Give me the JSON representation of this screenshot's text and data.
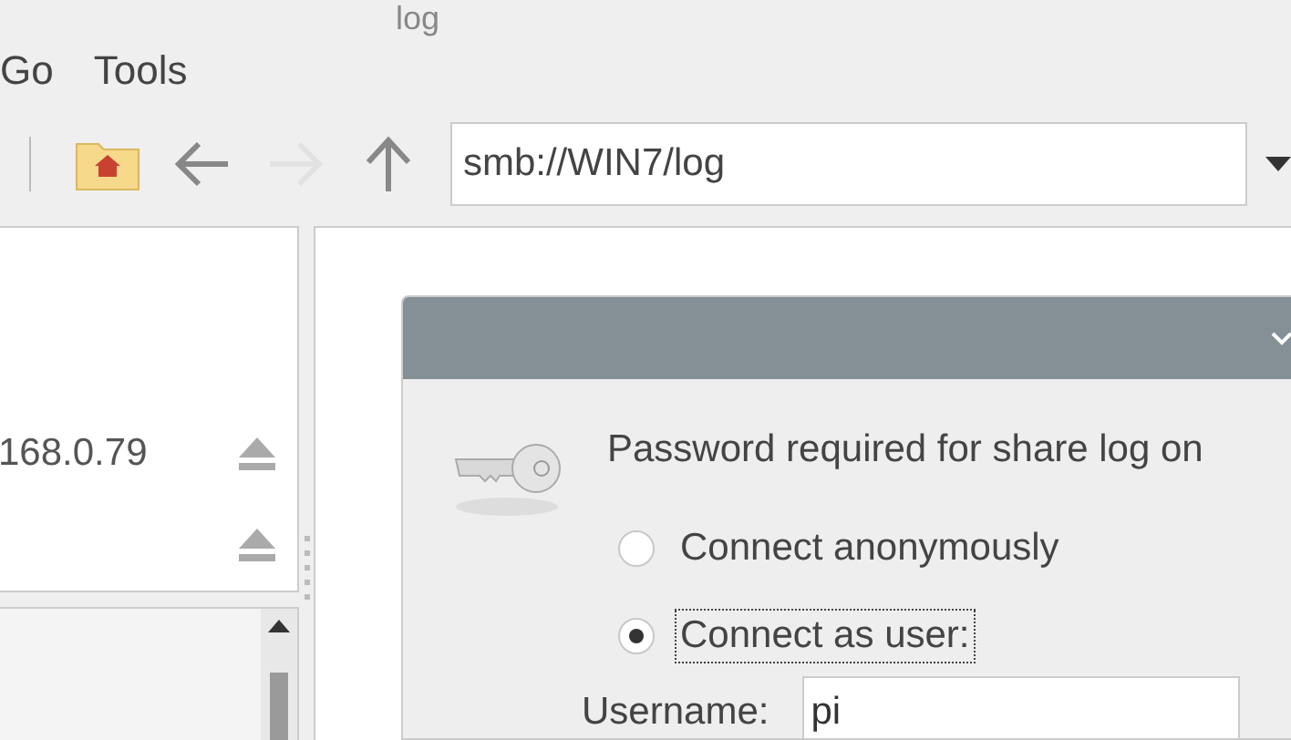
{
  "window": {
    "title": "log"
  },
  "menu": [
    "Go",
    "Tools"
  ],
  "nav_buttons": [
    {
      "kind": "home",
      "disabled": false
    },
    {
      "kind": "back",
      "disabled": false
    },
    {
      "kind": "forward",
      "disabled": true
    },
    {
      "kind": "up",
      "disabled": false
    }
  ],
  "address": {
    "value": "smb://WIN7/log"
  },
  "places": [
    {
      "label": "168.0.79",
      "ejectable": true
    },
    {
      "ejectable": true
    }
  ],
  "dialog": {
    "message": "Password required for share log on",
    "options": [
      {
        "label": "Connect anonymously",
        "selected": false,
        "focused": false
      },
      {
        "label": "Connect as user:",
        "selected": true,
        "focused": true
      }
    ],
    "fields": [
      {
        "label": "Username:",
        "value": "pi"
      }
    ]
  }
}
